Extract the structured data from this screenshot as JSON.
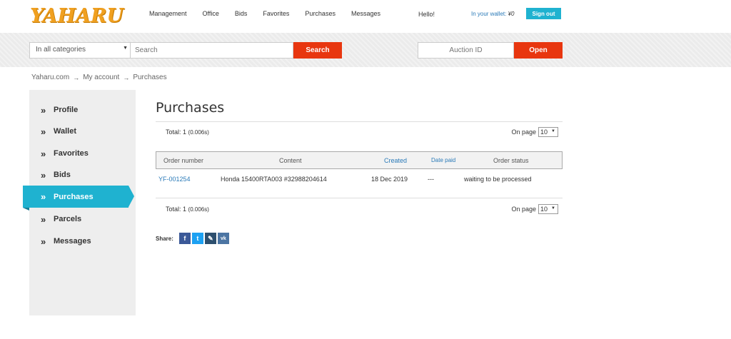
{
  "header": {
    "logo": "YAHARU",
    "nav": [
      "Management",
      "Office",
      "Bids",
      "Favorites",
      "Purchases",
      "Messages"
    ],
    "hello": "Hello!",
    "wallet_label": "In your wallet:",
    "wallet_amount": "¥0",
    "signout": "Sign out"
  },
  "search": {
    "category": "In all categories",
    "placeholder": "Search",
    "button": "Search",
    "auction_placeholder": "Auction ID",
    "open_button": "Open"
  },
  "breadcrumb": [
    "Yaharu.com",
    "My account",
    "Purchases"
  ],
  "sidebar": {
    "items": [
      "Profile",
      "Wallet",
      "Favorites",
      "Bids",
      "Purchases",
      "Parcels",
      "Messages"
    ],
    "active": "Purchases"
  },
  "main": {
    "title": "Purchases",
    "total_top": "Total: 1",
    "time_top": "(0.006s)",
    "onpage_label": "On page",
    "onpage_value": "10",
    "columns": [
      "Order number",
      "Content",
      "Created",
      "Date paid",
      "Order status"
    ],
    "rows": [
      {
        "order_number": "YF-001254",
        "content": "Honda 15400RTA003 #32988204614",
        "created": "18 Dec 2019",
        "date_paid": "---",
        "status": "waiting to be processed"
      }
    ],
    "total_bottom": "Total: 1",
    "time_bottom": "(0.006s)",
    "share_label": "Share:"
  },
  "share_icons": [
    {
      "glyph": "f",
      "color": "#3b5998"
    },
    {
      "glyph": "t",
      "color": "#1da1f2"
    },
    {
      "glyph": "✎",
      "color": "#2d4f6e"
    },
    {
      "glyph": "vk",
      "color": "#4c75a3"
    }
  ]
}
